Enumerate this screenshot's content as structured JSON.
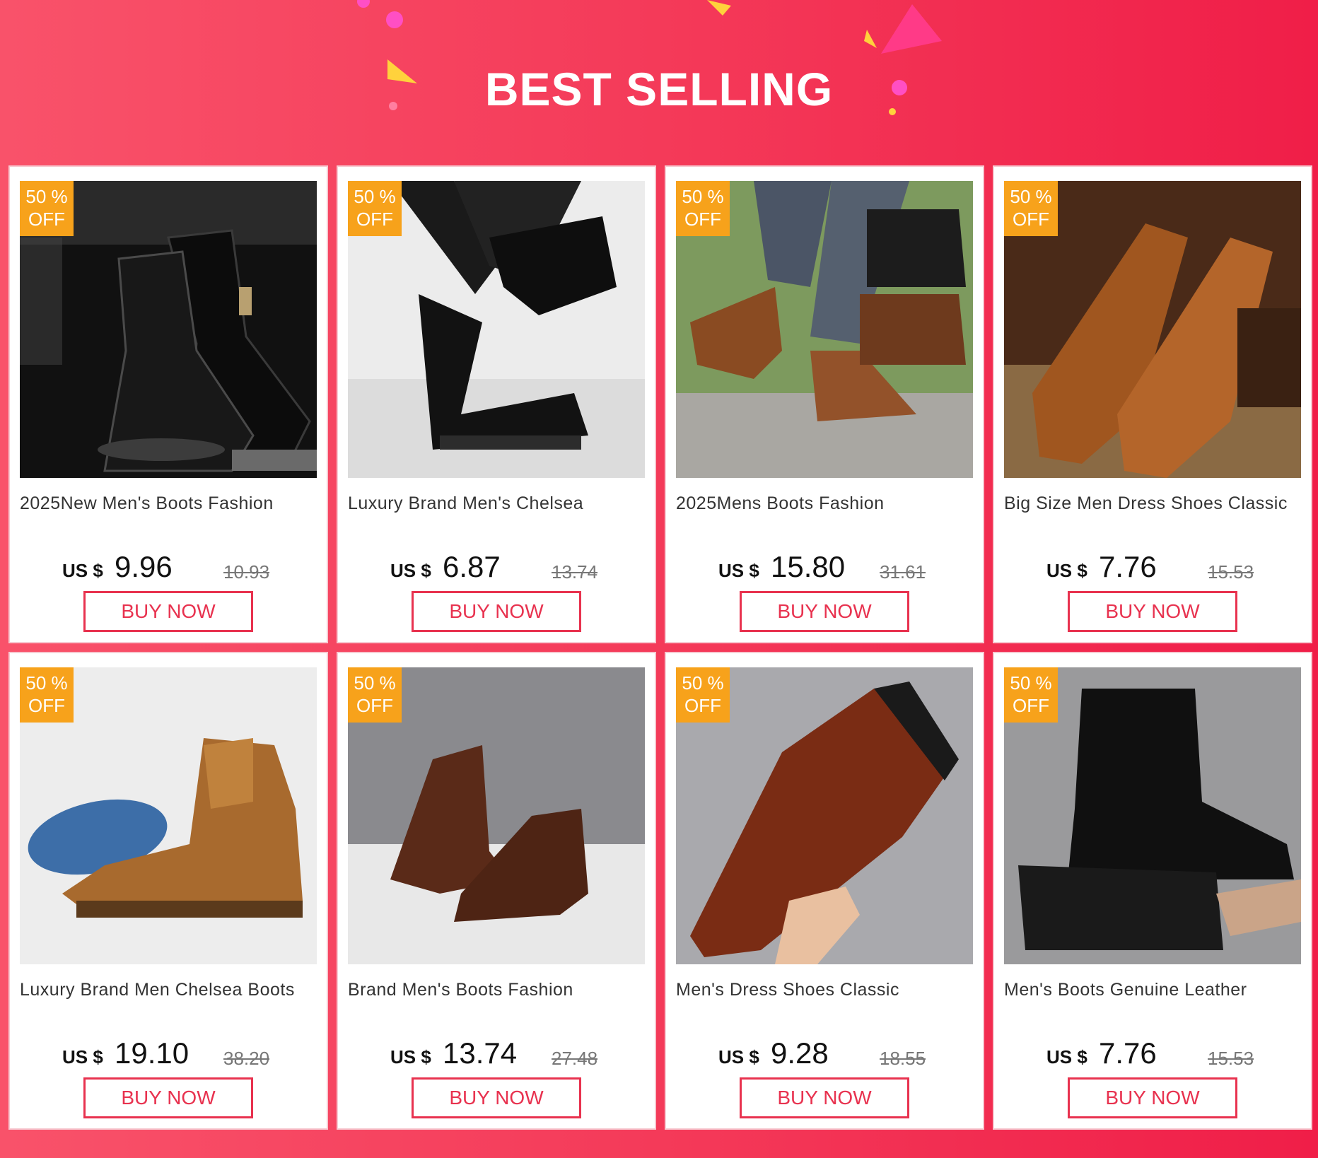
{
  "banner": {
    "title": "BEST SELLING"
  },
  "colors": {
    "accent": "#e8324f",
    "badge": "#f7a21b",
    "background": "#f43a59"
  },
  "products": [
    {
      "badge_pct": "50 %",
      "badge_off": "OFF",
      "title": "2025New Men's Boots Fashion",
      "currency": "US $",
      "price": "9.96",
      "original_price": "10.93",
      "button": "BUY NOW"
    },
    {
      "badge_pct": "50 %",
      "badge_off": "OFF",
      "title": "Luxury Brand Men's Chelsea",
      "currency": "US $",
      "price": "6.87",
      "original_price": "13.74",
      "button": "BUY NOW"
    },
    {
      "badge_pct": "50 %",
      "badge_off": "OFF",
      "title": "2025Mens Boots Fashion",
      "currency": "US $",
      "price": "15.80",
      "original_price": "31.61",
      "button": "BUY NOW"
    },
    {
      "badge_pct": "50 %",
      "badge_off": "OFF",
      "title": "Big Size Men Dress Shoes Classic",
      "currency": "US $",
      "price": "7.76",
      "original_price": "15.53",
      "button": "BUY NOW"
    },
    {
      "badge_pct": "50 %",
      "badge_off": "OFF",
      "title": "Luxury Brand Men Chelsea Boots",
      "currency": "US $",
      "price": "19.10",
      "original_price": "38.20",
      "button": "BUY NOW"
    },
    {
      "badge_pct": "50 %",
      "badge_off": "OFF",
      "title": "Brand Men's Boots Fashion",
      "currency": "US $",
      "price": "13.74",
      "original_price": "27.48",
      "button": "BUY NOW"
    },
    {
      "badge_pct": "50 %",
      "badge_off": "OFF",
      "title": "Men's Dress Shoes Classic",
      "currency": "US $",
      "price": "9.28",
      "original_price": "18.55",
      "button": "BUY NOW"
    },
    {
      "badge_pct": "50 %",
      "badge_off": "OFF",
      "title": "Men's Boots Genuine Leather",
      "currency": "US $",
      "price": "7.76",
      "original_price": "15.53",
      "button": "BUY NOW"
    }
  ]
}
